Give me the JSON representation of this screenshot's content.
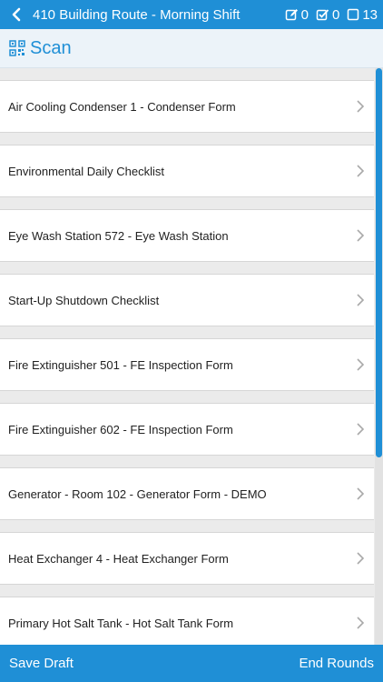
{
  "header": {
    "title": "410 Building Route - Morning Shift",
    "counters": [
      {
        "icon": "edit-icon",
        "value": "0"
      },
      {
        "icon": "checked-box-icon",
        "value": "0"
      },
      {
        "icon": "empty-box-icon",
        "value": "13"
      }
    ]
  },
  "scan": {
    "label": "Scan",
    "icon": "qr-code-icon"
  },
  "items": [
    "Air Cooling Condenser 1 - Condenser Form",
    "Environmental Daily Checklist",
    "Eye Wash Station 572 - Eye Wash Station",
    "Start-Up Shutdown Checklist",
    "Fire Extinguisher 501 - FE Inspection Form",
    "Fire Extinguisher 602 - FE Inspection Form",
    "Generator - Room 102 - Generator Form - DEMO",
    "Heat Exchanger 4 - Heat Exchanger Form",
    "Primary Hot Salt Tank - Hot Salt Tank Form"
  ],
  "footer": {
    "save_label": "Save Draft",
    "end_label": "End Rounds"
  },
  "colors": {
    "accent": "#1f8fd6",
    "scan_bg": "#ecf3f9"
  }
}
